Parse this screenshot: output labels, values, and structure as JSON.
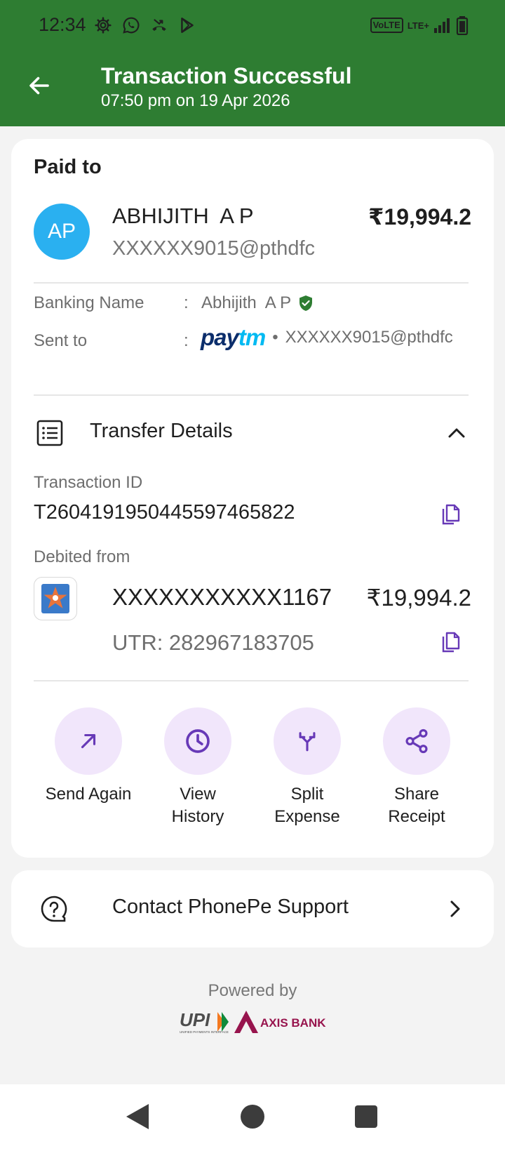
{
  "status_bar": {
    "time": "12:34",
    "left_icons": [
      "gear-icon",
      "whatsapp-icon",
      "missed-call-icon",
      "play-store-icon"
    ],
    "volte": "VoLTE",
    "network": "LTE+",
    "battery": "battery-icon"
  },
  "header": {
    "title": "Transaction Successful",
    "subtitle": "07:50 pm on 19 Apr 2026",
    "background": "#2e7d32"
  },
  "paid_to": {
    "section_label": "Paid to",
    "avatar_initials": "AP",
    "avatar_color": "#2ab0f0",
    "name": "ABHIJITH  A P",
    "vpa": "XXXXXX9015@pthdfc",
    "amount": "₹19,994.2"
  },
  "details": {
    "banking_name_label": "Banking Name",
    "banking_name_colon": ":",
    "banking_name_value": "Abhijith  A P",
    "sent_to_label": "Sent to",
    "sent_to_colon": ":",
    "sent_to_brand": "paytm",
    "sent_to_separator": "•",
    "sent_to_vpa": "XXXXXX9015@pthdfc"
  },
  "transfer": {
    "title": "Transfer Details",
    "txn_id_label": "Transaction ID",
    "txn_id": "T2604191950445597465822",
    "debited_from_label": "Debited from",
    "account": "XXXXXXXXXXX1167",
    "amount": "₹19,994.2",
    "utr": "UTR: 282967183705"
  },
  "actions": [
    {
      "label": "Send Again",
      "icon": "arrow-up-right-icon"
    },
    {
      "label": "View History",
      "icon": "clock-icon"
    },
    {
      "label": "Split Expense",
      "icon": "split-icon"
    },
    {
      "label": "Share Receipt",
      "icon": "share-icon"
    }
  ],
  "support": {
    "label": "Contact PhonePe Support"
  },
  "footer": {
    "powered_by": "Powered by",
    "upi_text": "UPI",
    "upi_tagline": "UNIFIED PAYMENTS INTERFACE",
    "bank_text": "AXIS BANK"
  },
  "colors": {
    "accent_purple": "#6739b7",
    "action_bg": "#f1e6fb",
    "verified_green": "#2e7d32",
    "paytm_dark": "#0b2d6b",
    "paytm_light": "#00baf2",
    "axis_maroon": "#97144d"
  }
}
